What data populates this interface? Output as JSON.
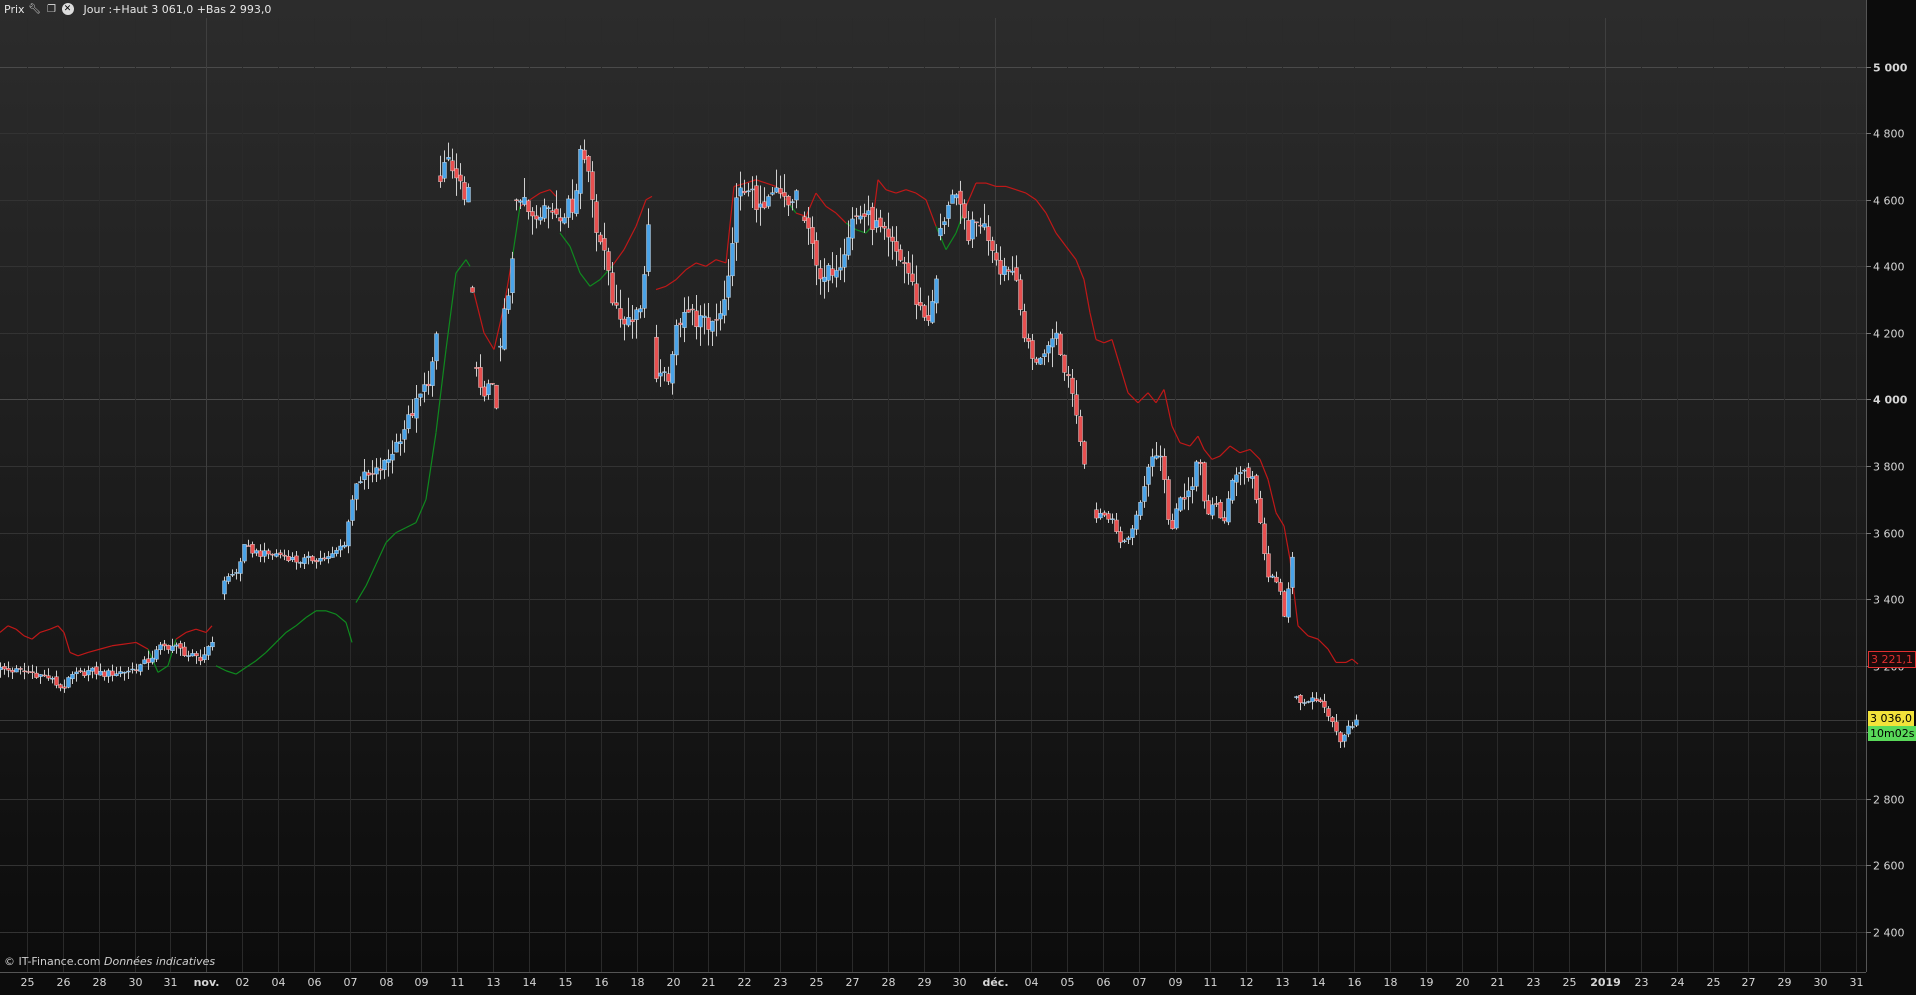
{
  "header": {
    "label": "Prix",
    "info": "Jour :+Haut 3 061,0 +Bas 2 993,0",
    "icons": [
      "wrench-icon",
      "window-icon",
      "close-icon"
    ]
  },
  "footer": {
    "copyright": "© IT-Finance.com",
    "note": "Données indicatives"
  },
  "price_tags": {
    "sar_value": "3 221,1",
    "last_price": "3 036,0",
    "countdown": "10m02s"
  },
  "colors": {
    "up_candle": "#4aa3e8",
    "down_candle": "#e85050",
    "sar_up": "#0f8a1f",
    "sar_down": "#c01818",
    "background_top": "#2c2c2c",
    "background_bottom": "#0c0c0c"
  },
  "chart_data": {
    "type": "candlestick",
    "title": "",
    "xlabel": "",
    "ylabel": "",
    "ylim": [
      2300,
      5150
    ],
    "grid": true,
    "y_ticks": [
      2400,
      2600,
      2800,
      3000,
      3200,
      3400,
      3600,
      3800,
      4000,
      4200,
      4400,
      4600,
      4800,
      5000
    ],
    "y_tick_labels": [
      "2 400",
      "2 600",
      "2 800",
      "3 000",
      "3 200",
      "3 400",
      "3 600",
      "3 800",
      "4 000",
      "4 200",
      "4 400",
      "4 600",
      "4 800",
      "5 000"
    ],
    "y_major_ticks": [
      4000,
      5000
    ],
    "x_tick_labels": [
      "25",
      "26",
      "28",
      "30",
      "31",
      "nov.",
      "02",
      "04",
      "06",
      "07",
      "08",
      "09",
      "11",
      "13",
      "14",
      "15",
      "16",
      "18",
      "20",
      "21",
      "22",
      "23",
      "25",
      "27",
      "28",
      "29",
      "30",
      "déc.",
      "04",
      "05",
      "06",
      "07",
      "09",
      "11",
      "12",
      "13",
      "14",
      "16",
      "18",
      "19",
      "20",
      "21",
      "23",
      "25",
      "2019",
      "23",
      "24",
      "25",
      "27",
      "29",
      "30",
      "31"
    ],
    "x_major_labels": [
      "nov.",
      "déc.",
      "2019"
    ],
    "series": [
      {
        "kind": "candles",
        "close_anchors": [
          [
            0,
            3190
          ],
          [
            30,
            3180
          ],
          [
            48,
            3165
          ],
          [
            62,
            3130
          ],
          [
            72,
            3170
          ],
          [
            90,
            3185
          ],
          [
            104,
            3175
          ],
          [
            118,
            3180
          ],
          [
            134,
            3190
          ],
          [
            148,
            3215
          ],
          [
            160,
            3255
          ],
          [
            174,
            3260
          ],
          [
            186,
            3235
          ],
          [
            200,
            3215
          ],
          [
            212,
            3280
          ],
          [
            222,
            3455
          ],
          [
            236,
            3480
          ],
          [
            244,
            3555
          ],
          [
            262,
            3535
          ],
          [
            282,
            3535
          ],
          [
            296,
            3515
          ],
          [
            312,
            3520
          ],
          [
            330,
            3525
          ],
          [
            344,
            3570
          ],
          [
            356,
            3760
          ],
          [
            372,
            3770
          ],
          [
            386,
            3810
          ],
          [
            398,
            3880
          ],
          [
            414,
            3975
          ],
          [
            430,
            4070
          ],
          [
            436,
            4180
          ],
          [
            440,
            4650
          ],
          [
            446,
            4740
          ],
          [
            456,
            4640
          ],
          [
            468,
            4620
          ],
          [
            472,
            4300
          ],
          [
            476,
            4100
          ],
          [
            480,
            4050
          ],
          [
            484,
            3990
          ],
          [
            490,
            4070
          ],
          [
            496,
            3970
          ],
          [
            502,
            4240
          ],
          [
            510,
            4350
          ],
          [
            516,
            4620
          ],
          [
            530,
            4560
          ],
          [
            544,
            4580
          ],
          [
            560,
            4560
          ],
          [
            574,
            4590
          ],
          [
            580,
            4750
          ],
          [
            590,
            4680
          ],
          [
            598,
            4450
          ],
          [
            606,
            4450
          ],
          [
            614,
            4260
          ],
          [
            626,
            4240
          ],
          [
            640,
            4280
          ],
          [
            648,
            4510
          ],
          [
            654,
            4060
          ],
          [
            670,
            4070
          ],
          [
            676,
            4210
          ],
          [
            684,
            4280
          ],
          [
            696,
            4240
          ],
          [
            708,
            4220
          ],
          [
            720,
            4270
          ],
          [
            730,
            4380
          ],
          [
            736,
            4620
          ],
          [
            752,
            4620
          ],
          [
            762,
            4560
          ],
          [
            776,
            4620
          ],
          [
            788,
            4580
          ],
          [
            796,
            4620
          ],
          [
            802,
            4520
          ],
          [
            812,
            4490
          ],
          [
            820,
            4340
          ],
          [
            830,
            4390
          ],
          [
            840,
            4420
          ],
          [
            852,
            4540
          ],
          [
            862,
            4560
          ],
          [
            876,
            4520
          ],
          [
            886,
            4480
          ],
          [
            896,
            4440
          ],
          [
            906,
            4400
          ],
          [
            916,
            4300
          ],
          [
            926,
            4240
          ],
          [
            934,
            4290
          ],
          [
            940,
            4500
          ],
          [
            950,
            4620
          ],
          [
            958,
            4580
          ],
          [
            968,
            4500
          ],
          [
            980,
            4540
          ],
          [
            990,
            4480
          ],
          [
            1000,
            4400
          ],
          [
            1010,
            4400
          ],
          [
            1018,
            4350
          ],
          [
            1024,
            4190
          ],
          [
            1032,
            4120
          ],
          [
            1044,
            4130
          ],
          [
            1054,
            4220
          ],
          [
            1062,
            4100
          ],
          [
            1070,
            4060
          ],
          [
            1078,
            3920
          ],
          [
            1086,
            3790
          ],
          [
            1094,
            3640
          ],
          [
            1104,
            3660
          ],
          [
            1112,
            3640
          ],
          [
            1120,
            3560
          ],
          [
            1132,
            3610
          ],
          [
            1142,
            3700
          ],
          [
            1150,
            3840
          ],
          [
            1162,
            3810
          ],
          [
            1170,
            3590
          ],
          [
            1178,
            3700
          ],
          [
            1190,
            3720
          ],
          [
            1198,
            3840
          ],
          [
            1206,
            3640
          ],
          [
            1214,
            3700
          ],
          [
            1222,
            3620
          ],
          [
            1232,
            3740
          ],
          [
            1242,
            3810
          ],
          [
            1252,
            3760
          ],
          [
            1260,
            3620
          ],
          [
            1268,
            3460
          ],
          [
            1278,
            3460
          ],
          [
            1284,
            3350
          ],
          [
            1292,
            3530
          ],
          [
            1296,
            3110
          ],
          [
            1304,
            3080
          ],
          [
            1316,
            3100
          ],
          [
            1326,
            3070
          ],
          [
            1334,
            3010
          ],
          [
            1340,
            2980
          ],
          [
            1348,
            3020
          ],
          [
            1358,
            3036
          ]
        ]
      },
      {
        "kind": "parabolic_sar",
        "points": [
          [
            0,
            3300
          ],
          [
            8,
            3320
          ],
          [
            16,
            3310
          ],
          [
            24,
            3290
          ],
          [
            32,
            3280
          ],
          [
            40,
            3300
          ],
          [
            50,
            3310
          ],
          [
            58,
            3320
          ],
          [
            64,
            3300
          ],
          [
            70,
            3240
          ],
          [
            78,
            3230
          ],
          [
            88,
            3240
          ],
          [
            100,
            3250
          ],
          [
            112,
            3260
          ],
          [
            124,
            3265
          ],
          [
            136,
            3270
          ],
          [
            148,
            3250
          ],
          [
            158,
            3180
          ],
          [
            168,
            3200
          ],
          [
            176,
            3280
          ],
          [
            186,
            3300
          ],
          [
            196,
            3310
          ],
          [
            206,
            3300
          ],
          [
            212,
            3320
          ],
          [
            216,
            3200
          ],
          [
            226,
            3185
          ],
          [
            236,
            3175
          ],
          [
            246,
            3195
          ],
          [
            256,
            3215
          ],
          [
            266,
            3240
          ],
          [
            276,
            3270
          ],
          [
            286,
            3300
          ],
          [
            296,
            3320
          ],
          [
            306,
            3345
          ],
          [
            316,
            3365
          ],
          [
            326,
            3365
          ],
          [
            336,
            3355
          ],
          [
            346,
            3330
          ],
          [
            352,
            3270
          ],
          [
            356,
            3390
          ],
          [
            366,
            3440
          ],
          [
            376,
            3505
          ],
          [
            386,
            3570
          ],
          [
            396,
            3600
          ],
          [
            406,
            3615
          ],
          [
            416,
            3630
          ],
          [
            426,
            3700
          ],
          [
            436,
            3900
          ],
          [
            446,
            4150
          ],
          [
            456,
            4380
          ],
          [
            466,
            4420
          ],
          [
            470,
            4400
          ],
          [
            474,
            4320
          ],
          [
            484,
            4200
          ],
          [
            494,
            4150
          ],
          [
            504,
            4280
          ],
          [
            512,
            4420
          ],
          [
            520,
            4580
          ],
          [
            530,
            4600
          ],
          [
            540,
            4620
          ],
          [
            550,
            4630
          ],
          [
            556,
            4610
          ],
          [
            560,
            4500
          ],
          [
            570,
            4460
          ],
          [
            580,
            4380
          ],
          [
            590,
            4340
          ],
          [
            600,
            4360
          ],
          [
            612,
            4400
          ],
          [
            624,
            4450
          ],
          [
            636,
            4520
          ],
          [
            646,
            4600
          ],
          [
            652,
            4610
          ],
          [
            656,
            4330
          ],
          [
            666,
            4340
          ],
          [
            676,
            4360
          ],
          [
            686,
            4390
          ],
          [
            696,
            4410
          ],
          [
            706,
            4400
          ],
          [
            716,
            4420
          ],
          [
            726,
            4410
          ],
          [
            734,
            4640
          ],
          [
            746,
            4650
          ],
          [
            756,
            4660
          ],
          [
            766,
            4650
          ],
          [
            776,
            4640
          ],
          [
            786,
            4600
          ],
          [
            796,
            4560
          ],
          [
            806,
            4550
          ],
          [
            816,
            4620
          ],
          [
            826,
            4580
          ],
          [
            836,
            4560
          ],
          [
            846,
            4530
          ],
          [
            856,
            4510
          ],
          [
            866,
            4500
          ],
          [
            872,
            4520
          ],
          [
            878,
            4660
          ],
          [
            886,
            4630
          ],
          [
            896,
            4620
          ],
          [
            906,
            4630
          ],
          [
            916,
            4620
          ],
          [
            926,
            4600
          ],
          [
            936,
            4520
          ],
          [
            946,
            4450
          ],
          [
            956,
            4500
          ],
          [
            966,
            4580
          ],
          [
            976,
            4650
          ],
          [
            986,
            4650
          ],
          [
            996,
            4640
          ],
          [
            1006,
            4640
          ],
          [
            1016,
            4630
          ],
          [
            1026,
            4620
          ],
          [
            1036,
            4600
          ],
          [
            1046,
            4560
          ],
          [
            1056,
            4500
          ],
          [
            1066,
            4460
          ],
          [
            1076,
            4420
          ],
          [
            1084,
            4360
          ],
          [
            1090,
            4260
          ],
          [
            1096,
            4180
          ],
          [
            1104,
            4170
          ],
          [
            1112,
            4180
          ],
          [
            1120,
            4100
          ],
          [
            1128,
            4020
          ],
          [
            1138,
            3990
          ],
          [
            1148,
            4020
          ],
          [
            1156,
            3990
          ],
          [
            1164,
            4030
          ],
          [
            1172,
            3920
          ],
          [
            1180,
            3870
          ],
          [
            1190,
            3860
          ],
          [
            1198,
            3890
          ],
          [
            1204,
            3850
          ],
          [
            1212,
            3820
          ],
          [
            1220,
            3830
          ],
          [
            1230,
            3860
          ],
          [
            1240,
            3840
          ],
          [
            1250,
            3850
          ],
          [
            1260,
            3820
          ],
          [
            1268,
            3760
          ],
          [
            1276,
            3660
          ],
          [
            1284,
            3620
          ],
          [
            1290,
            3520
          ],
          [
            1298,
            3320
          ],
          [
            1308,
            3290
          ],
          [
            1318,
            3280
          ],
          [
            1328,
            3250
          ],
          [
            1336,
            3210
          ],
          [
            1346,
            3210
          ],
          [
            1352,
            3220
          ],
          [
            1358,
            3205
          ]
        ]
      }
    ],
    "last_price": 3036,
    "sar_last": 3221.1,
    "day_high": 3061,
    "day_low": 2993
  }
}
